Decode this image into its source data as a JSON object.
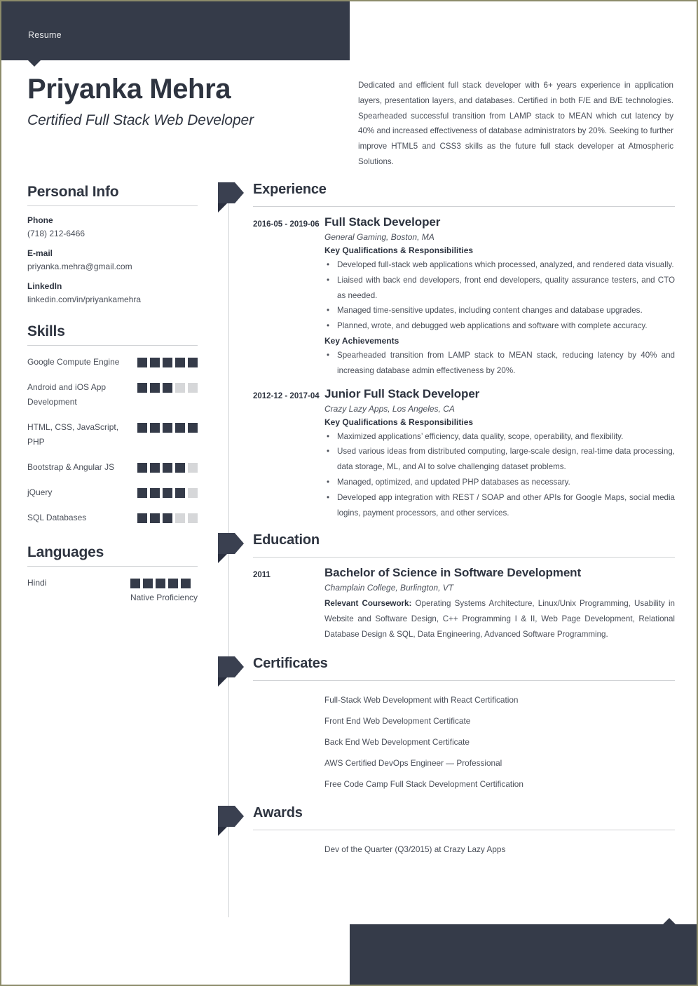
{
  "header": {
    "label": "Resume"
  },
  "identity": {
    "name": "Priyanka Mehra",
    "title": "Certified Full Stack Web Developer",
    "summary": "Dedicated and efficient full stack developer with 6+ years experience in application layers, presentation layers, and databases. Certified in both F/E and B/E technologies. Spearheaded successful transition from LAMP stack to MEAN which cut latency by 40% and increased effectiveness of database administrators by 20%. Seeking to further improve HTML5 and CSS3 skills as the future full stack developer at Atmospheric Solutions."
  },
  "colors": {
    "dark_navy": "#353b49",
    "ribbon": "#3a4050",
    "ribbon_fold": "#2b3040",
    "rule": "#cfd1d4",
    "square_empty": "#d6d7d9",
    "body_text": "#4a4f59",
    "page_border": "#8d8c6a"
  },
  "personal_info": {
    "heading": "Personal Info",
    "fields": [
      {
        "label": "Phone",
        "value": "(718) 212-6466"
      },
      {
        "label": "E-mail",
        "value": "priyanka.mehra@gmail.com"
      },
      {
        "label": "LinkedIn",
        "value": "linkedin.com/in/priyankamehra"
      }
    ]
  },
  "skills": {
    "heading": "Skills",
    "max": 5,
    "items": [
      {
        "name": "Google Compute Engine",
        "level": 5
      },
      {
        "name": "Android and iOS App Development",
        "level": 3
      },
      {
        "name": "HTML, CSS, JavaScript, PHP",
        "level": 5
      },
      {
        "name": "Bootstrap & Angular JS",
        "level": 4
      },
      {
        "name": "jQuery",
        "level": 4
      },
      {
        "name": "SQL Databases",
        "level": 3
      }
    ]
  },
  "languages": {
    "heading": "Languages",
    "max": 5,
    "items": [
      {
        "name": "Hindi",
        "level": 5,
        "proficiency": "Native Proficiency"
      }
    ]
  },
  "experience": {
    "heading": "Experience",
    "entries": [
      {
        "date": "2016-05 - 2019-06",
        "title": "Full Stack Developer",
        "company": "General Gaming, Boston, MA",
        "qualifications_label": "Key Qualifications & Responsibilities",
        "qualifications": [
          "Developed full-stack web applications which processed, analyzed, and rendered data visually.",
          "Liaised with back end developers, front end developers, quality assurance testers, and CTO as needed.",
          "Managed time-sensitive updates, including content changes and database upgrades.",
          "Planned, wrote, and debugged web applications and software with complete accuracy."
        ],
        "achievements_label": "Key Achievements",
        "achievements": [
          "Spearheaded transition from LAMP stack to MEAN stack, reducing latency by 40% and increasing database admin effectiveness by 20%."
        ]
      },
      {
        "date": "2012-12 - 2017-04",
        "title": "Junior Full Stack Developer",
        "company": "Crazy Lazy Apps, Los Angeles, CA",
        "qualifications_label": "Key Qualifications & Responsibilities",
        "qualifications": [
          "Maximized applications’ efficiency, data quality, scope, operability, and flexibility.",
          "Used various ideas from distributed computing, large-scale design, real-time data processing, data storage, ML, and AI to solve challenging dataset problems.",
          "Managed, optimized, and updated PHP databases as necessary.",
          "Developed app integration with REST / SOAP and other APIs for Google Maps, social media logins, payment processors, and other services."
        ],
        "achievements_label": "",
        "achievements": []
      }
    ]
  },
  "education": {
    "heading": "Education",
    "entries": [
      {
        "date": "2011",
        "degree": "Bachelor of Science in Software Development",
        "school": "Champlain College, Burlington, VT",
        "coursework_label": "Relevant Coursework:",
        "coursework": " Operating Systems Architecture, Linux/Unix Programming, Usability in Website and Software Design, C++ Programming I & II, Web Page Development, Relational Database Design & SQL, Data Engineering, Advanced Software Programming."
      }
    ]
  },
  "certificates": {
    "heading": "Certificates",
    "items": [
      "Full-Stack Web Development with React Certification",
      "Front End Web Development Certificate",
      "Back End Web Development Certificate",
      "AWS Certified DevOps Engineer — Professional",
      "Free Code Camp Full Stack Development Certification"
    ]
  },
  "awards": {
    "heading": "Awards",
    "items": [
      "Dev of the Quarter (Q3/2015) at Crazy Lazy Apps"
    ]
  }
}
